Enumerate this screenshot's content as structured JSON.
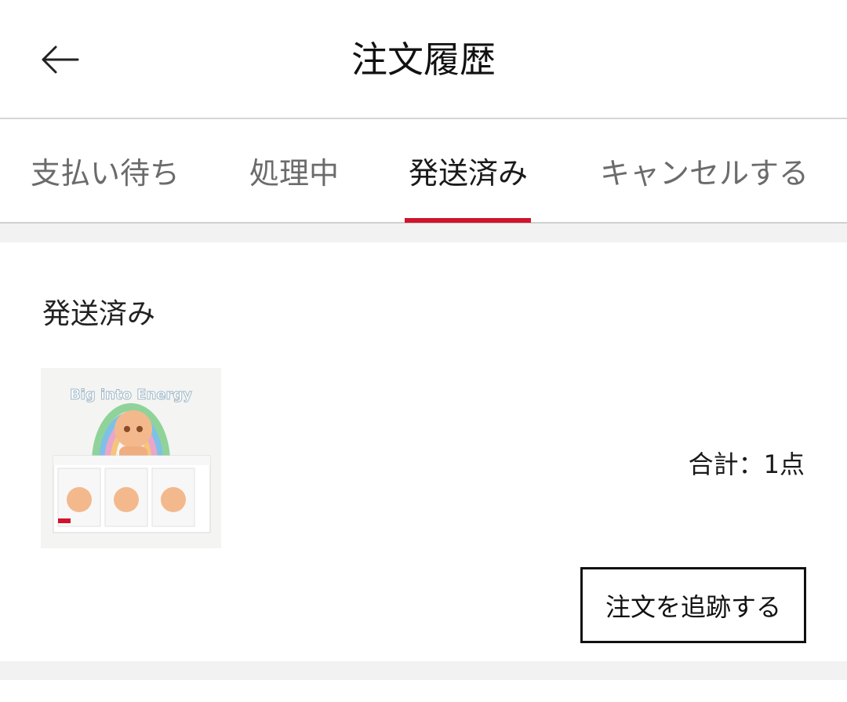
{
  "header": {
    "back_icon": "arrow-left-icon",
    "title": "注文履歴"
  },
  "tabs": [
    {
      "label": "支払い待ち",
      "active": false
    },
    {
      "label": "処理中",
      "active": false
    },
    {
      "label": "発送済み",
      "active": true
    },
    {
      "label": "キャンセルする",
      "active": false
    }
  ],
  "colors": {
    "accent": "#d0142c",
    "background_gap": "#f2f2f2",
    "text": "#1a1a1a",
    "inactive_tab": "#6b6b6b"
  },
  "order": {
    "status": "発送済み",
    "product_image_text": "Big into Energy",
    "quantity_label": "合計：",
    "quantity_value": "1点",
    "track_button": "注文を追跡する"
  }
}
